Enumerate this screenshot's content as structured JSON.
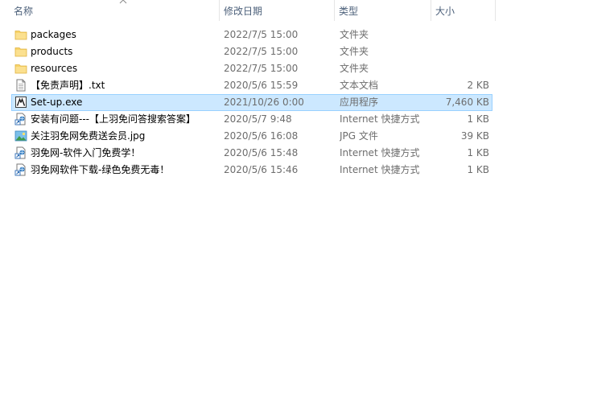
{
  "columns": {
    "name": "名称",
    "date": "修改日期",
    "type": "类型",
    "size": "大小"
  },
  "sort_column": "name",
  "colors": {
    "selected_bg": "#cce8ff",
    "selected_border": "#99d1ff",
    "header_text": "#4c607a",
    "secondary_text": "#6d6d6d",
    "folder": "#f8d46a"
  },
  "files": [
    {
      "name": "packages",
      "date": "2022/7/5 15:00",
      "type": "文件夹",
      "size": "",
      "icon": "folder-icon"
    },
    {
      "name": "products",
      "date": "2022/7/5 15:00",
      "type": "文件夹",
      "size": "",
      "icon": "folder-icon"
    },
    {
      "name": "resources",
      "date": "2022/7/5 15:00",
      "type": "文件夹",
      "size": "",
      "icon": "folder-icon"
    },
    {
      "name": "【免责声明】.txt",
      "date": "2020/5/6 15:59",
      "type": "文本文档",
      "size": "2 KB",
      "icon": "text-file-icon"
    },
    {
      "name": "Set-up.exe",
      "date": "2021/10/26 0:00",
      "type": "应用程序",
      "size": "7,460 KB",
      "icon": "adobe-installer-icon",
      "selected": true
    },
    {
      "name": "安装有问题---【上羽免问答搜索答案】",
      "date": "2020/5/7 9:48",
      "type": "Internet 快捷方式",
      "size": "1 KB",
      "icon": "internet-shortcut-icon"
    },
    {
      "name": "关注羽免网免费送会员.jpg",
      "date": "2020/5/6 16:08",
      "type": "JPG 文件",
      "size": "39 KB",
      "icon": "image-file-icon"
    },
    {
      "name": "羽免网-软件入门免费学！",
      "date": "2020/5/6 15:48",
      "type": "Internet 快捷方式",
      "size": "1 KB",
      "icon": "internet-shortcut-icon"
    },
    {
      "name": "羽免网软件下载-绿色免费无毒！",
      "date": "2020/5/6 15:46",
      "type": "Internet 快捷方式",
      "size": "1 KB",
      "icon": "internet-shortcut-icon"
    }
  ]
}
